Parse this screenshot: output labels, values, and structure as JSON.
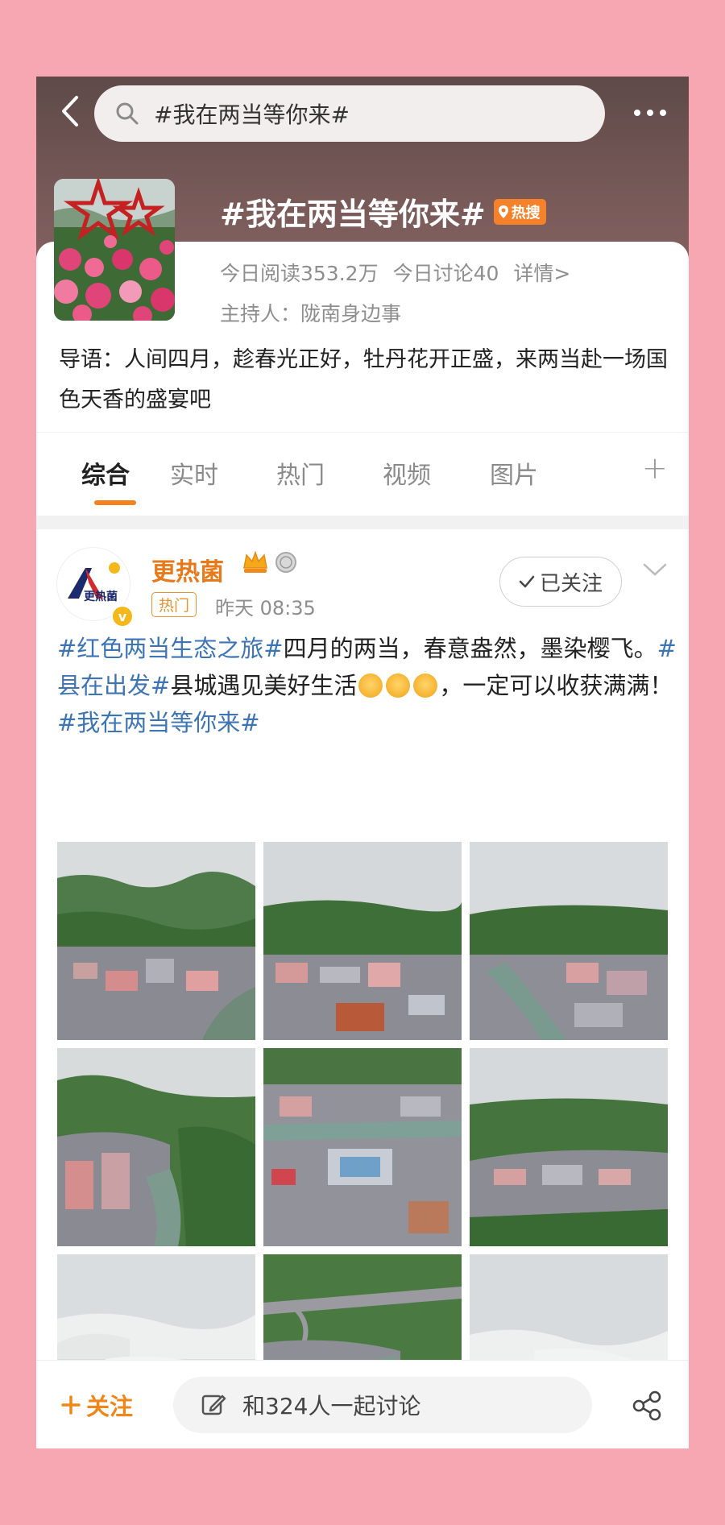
{
  "header": {
    "search_text": "#我在两当等你来#",
    "topic_title": "#我在两当等你来#",
    "hot_badge": "热搜"
  },
  "topic": {
    "reads": "今日阅读353.2万",
    "discussions": "今日讨论40",
    "details_link": "详情>",
    "host": "主持人：陇南身边事",
    "intro": "导语：人间四月，趁春光正好，牡丹花开正盛，来两当赴一场国色天香的盛宴吧"
  },
  "tabs": [
    {
      "label": "综合",
      "active": true
    },
    {
      "label": "实时",
      "active": false
    },
    {
      "label": "热门",
      "active": false
    },
    {
      "label": "视频",
      "active": false
    },
    {
      "label": "图片",
      "active": false
    }
  ],
  "tab_add": "+",
  "post": {
    "author": "更热菌",
    "avatar_logo": "更热菌",
    "tag": "热门",
    "time": "昨天 08:35",
    "follow_label": "已关注",
    "text_parts": {
      "hashtag1": "#红色两当生态之旅#",
      "text1": "四月的两当，春意盎然，墨染樱飞。",
      "hashtag2": "#县在出发#",
      "text2": "县城遇见美好生活",
      "text3": "，一定可以收获满满！",
      "hashtag3": "#我在两当等你来#"
    },
    "photo_count": 9
  },
  "bottom_bar": {
    "follow_label": "关注",
    "discuss_label": "和324人一起讨论"
  },
  "colors": {
    "accent_orange": "#f58220",
    "hashtag_blue": "#3d74b5",
    "background_pink": "#f7a7b1"
  }
}
